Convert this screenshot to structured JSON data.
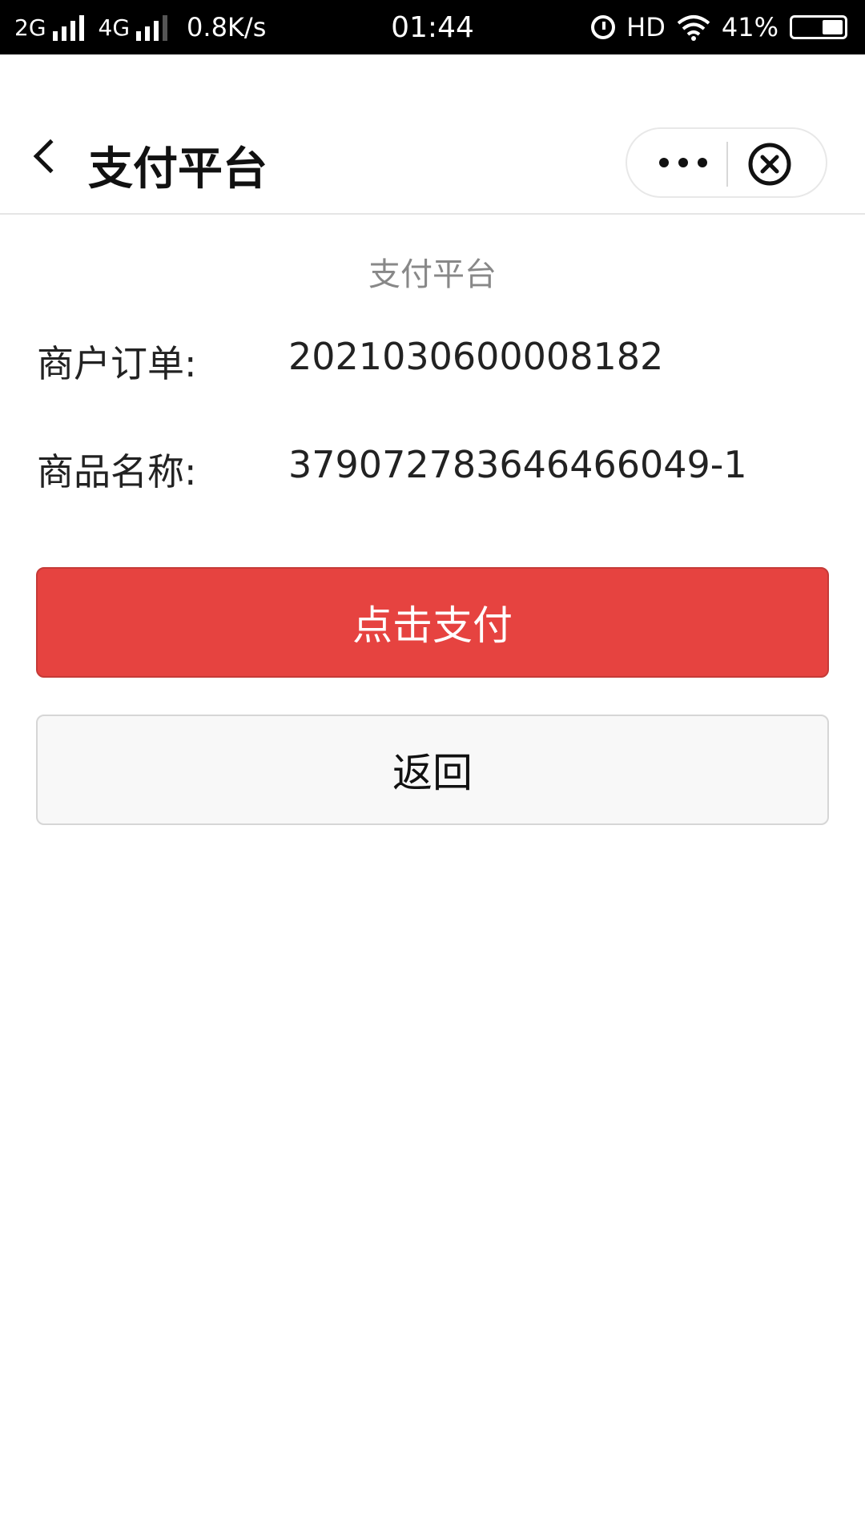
{
  "status_bar": {
    "net1": "2G",
    "net2": "4G",
    "speed": "0.8K/s",
    "time": "01:44",
    "hd": "HD",
    "battery_text": "41%",
    "battery_level": 0.41
  },
  "nav": {
    "title": "支付平台"
  },
  "page": {
    "subtitle": "支付平台",
    "order_label": "商户订单:",
    "order_value": "2021030600008182",
    "goods_label": "商品名称:",
    "goods_value": "379072783646466049-1",
    "pay_button": "点击支付",
    "back_button": "返回"
  },
  "colors": {
    "pay_button": "#e64340",
    "back_button": "#f8f8f8",
    "status_bar": "#000000"
  }
}
